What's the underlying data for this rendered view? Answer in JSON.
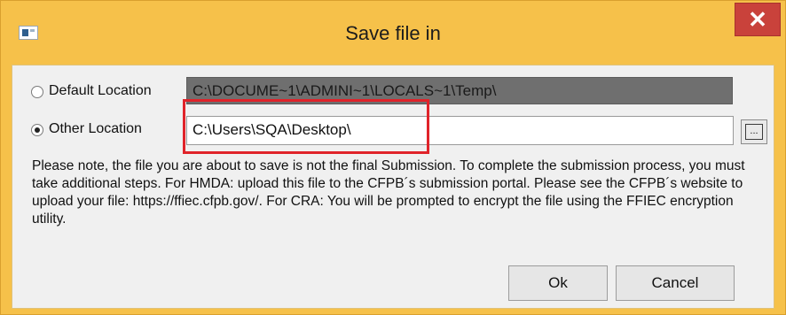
{
  "window": {
    "title": "Save file in",
    "close_label": "✕"
  },
  "options": {
    "default": {
      "label": "Default Location",
      "path": "C:\\DOCUME~1\\ADMINI~1\\LOCALS~1\\Temp\\",
      "selected": false
    },
    "other": {
      "label": "Other  Location",
      "path": "C:\\Users\\SQA\\Desktop\\",
      "selected": true
    },
    "browse_label": "..."
  },
  "note": "Please note, the file you are about to save is not the final Submission. To complete the submission process, you must take additional steps. For HMDA: upload this file to the CFPB´s submission portal. Please see the CFPB´s website to upload your file: https://ffiec.cfpb.gov/. For CRA: You will be prompted to encrypt the file using the FFIEC encryption utility.",
  "buttons": {
    "ok": "Ok",
    "cancel": "Cancel"
  },
  "colors": {
    "titlebar": "#f6c14a",
    "close": "#c9423b",
    "highlight": "#e0232a",
    "disabled_field": "#6f6f6f"
  },
  "icons": {
    "app": "application-window-icon",
    "close": "close-icon",
    "browse": "ellipsis-icon"
  }
}
